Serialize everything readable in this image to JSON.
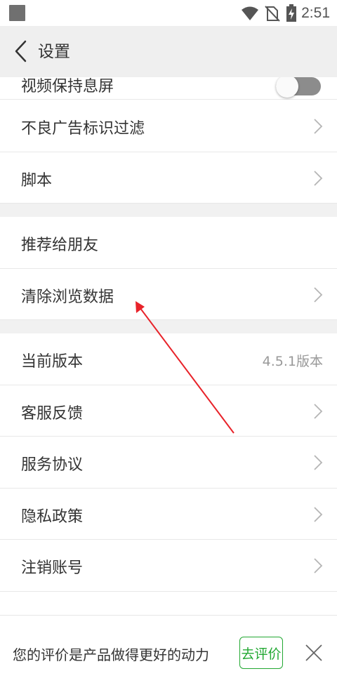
{
  "status_bar": {
    "time": "2:51",
    "icons": [
      "notification-icon",
      "wifi-icon",
      "no-sim-icon",
      "battery-charging-icon"
    ]
  },
  "header": {
    "back_icon": "chevron-left-icon",
    "title": "设置"
  },
  "settings": {
    "partial_item": {
      "label": "视频保持息屏",
      "toggle_on": false
    },
    "group1": [
      {
        "label": "不良广告标识过滤",
        "chevron": true
      },
      {
        "label": "脚本",
        "chevron": true
      }
    ],
    "group2": [
      {
        "label": "推荐给朋友",
        "chevron": false
      },
      {
        "label": "清除浏览数据",
        "chevron": true
      }
    ],
    "group3": [
      {
        "label": "当前版本",
        "value": "4.5.1版本",
        "chevron": false
      },
      {
        "label": "客服反馈",
        "chevron": true
      },
      {
        "label": "服务协议",
        "chevron": true
      },
      {
        "label": "隐私政策",
        "chevron": true
      },
      {
        "label": "注销账号",
        "chevron": true
      }
    ]
  },
  "rating_bar": {
    "text": "您的评价是产品做得更好的动力",
    "button_label": "去评价",
    "close_icon": "close-icon"
  },
  "colors": {
    "accent_green": "#22a832",
    "annotation_arrow": "#e8232a",
    "header_bg": "#efefef",
    "divider_gap": "#f1f1f1"
  }
}
